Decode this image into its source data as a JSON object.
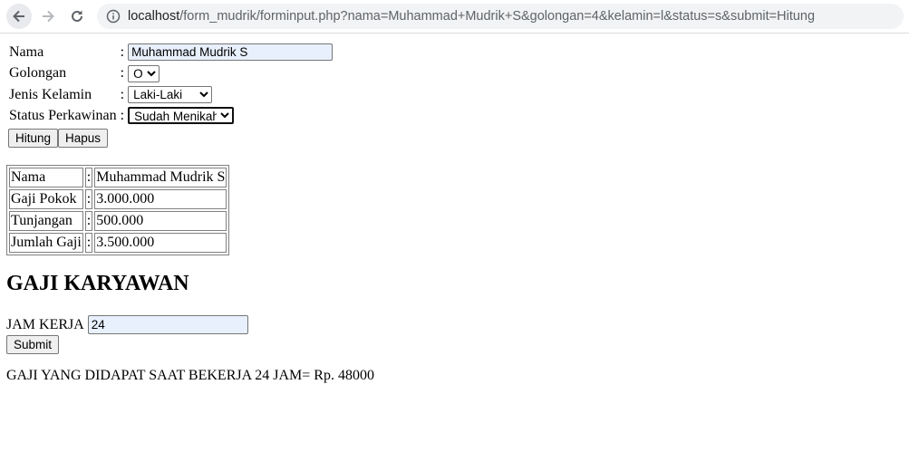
{
  "browser": {
    "url_host": "localhost",
    "url_path": "/form_mudrik/forminput.php?nama=Muhammad+Mudrik+S&golongan=4&kelamin=l&status=s&submit=Hitung"
  },
  "form": {
    "nama": {
      "label": "Nama",
      "sep": ":",
      "value": "Muhammad Mudrik S"
    },
    "golongan": {
      "label": "Golongan",
      "sep": ":",
      "value": "O"
    },
    "kelamin": {
      "label": "Jenis Kelamin",
      "sep": ":",
      "value": "Laki-Laki"
    },
    "status": {
      "label": "Status Perkawinan",
      "sep": ":",
      "value": "Sudah Menikah"
    },
    "hitung_label": "Hitung",
    "hapus_label": "Hapus"
  },
  "result": [
    {
      "label": "Nama",
      "sep": ":",
      "value": "Muhammad Mudrik S"
    },
    {
      "label": "Gaji Pokok",
      "sep": ":",
      "value": "3.000.000"
    },
    {
      "label": "Tunjangan",
      "sep": ":",
      "value": "500.000"
    },
    {
      "label": "Jumlah Gaji",
      "sep": ":",
      "value": "3.500.000"
    }
  ],
  "gaji": {
    "heading": "GAJI KARYAWAN",
    "jam_label": "JAM KERJA",
    "jam_value": "24",
    "submit_label": "Submit",
    "output": "GAJI YANG DIDAPAT SAAT BEKERJA 24 JAM= Rp. 48000"
  }
}
